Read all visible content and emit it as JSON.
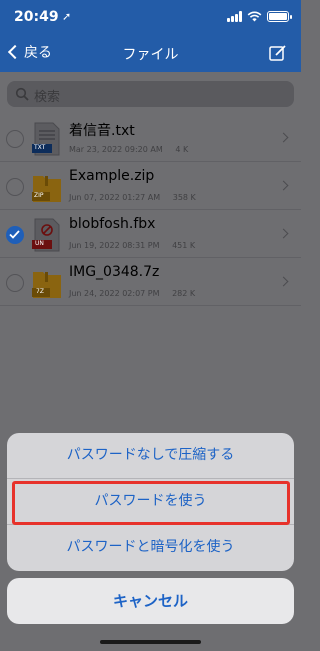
{
  "status_bar": {
    "time": "20:49",
    "location_glyph": "➚"
  },
  "nav": {
    "back_label": "戻る",
    "title": "ファイル"
  },
  "search": {
    "placeholder": "検索"
  },
  "files": [
    {
      "name": "着信音.txt",
      "date": "Mar 23, 2022 09:20 AM",
      "size": "4 K",
      "type": "TXT",
      "checked": false
    },
    {
      "name": "Example.zip",
      "date": "Jun 07, 2022 01:27 AM",
      "size": "358 K",
      "type": "ZIP",
      "checked": false
    },
    {
      "name": "blobfosh.fbx",
      "date": "Jun 19, 2022 08:31 PM",
      "size": "451 K",
      "type": "UN",
      "checked": true
    },
    {
      "name": "IMG_0348.7z",
      "date": "Jun 24, 2022 02:07 PM",
      "size": "282 K",
      "type": "7Z",
      "checked": false
    }
  ],
  "action_sheet": {
    "compress_no_password": "パスワードなしで圧縮する",
    "use_password": "パスワードを使う",
    "use_password_encrypt": "パスワードと暗号化を使う",
    "cancel": "キャンセル"
  },
  "colors": {
    "nav_bg": "#235ca8",
    "accent": "#1d63c6",
    "highlight": "#e7322b"
  }
}
